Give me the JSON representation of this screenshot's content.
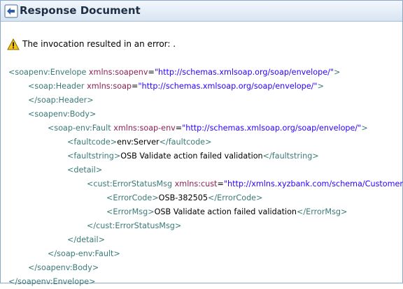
{
  "header": {
    "title": "Response Document",
    "back_icon": "back-arrow-icon"
  },
  "warning": {
    "icon": "warning-icon",
    "text": "The invocation resulted in an error: ."
  },
  "xml": {
    "l1_tag": "<soapenv:Envelope",
    "l1_attr": "xmlns:soapenv",
    "l1_eq": "=",
    "l1_val": "\"http://schemas.xmlsoap.org/soap/envelope/\"",
    "l1_end": ">",
    "l2_tag": "<soap:Header",
    "l2_attr": "xmlns:soap",
    "l2_eq": "=",
    "l2_val": "\"http://schemas.xmlsoap.org/soap/envelope/\"",
    "l2_end": ">",
    "l3_tag": "</soap:Header>",
    "l4_tag": "<soapenv:Body>",
    "l5_tag": "<soap-env:Fault",
    "l5_attr": "xmlns:soap-env",
    "l5_eq": "=",
    "l5_val": "\"http://schemas.xmlsoap.org/soap/envelope/\"",
    "l5_end": ">",
    "l6_open": "<faultcode>",
    "l6_text": "env:Server",
    "l6_close": "</faultcode>",
    "l7_open": "<faultstring>",
    "l7_text": "OSB Validate action failed validation",
    "l7_close": "</faultstring>",
    "l8_tag": "<detail>",
    "l9_tag": "<cust:ErrorStatusMsg",
    "l9_attr": "xmlns:cust",
    "l9_eq": "=",
    "l9_val": "\"http://xmlns.xyzbank.com/schema/Customer\"",
    "l9_end": ">",
    "l10_open": "<ErrorCode>",
    "l10_text": "OSB-382505",
    "l10_close": "</ErrorCode>",
    "l11_open": "<ErrorMsg>",
    "l11_text": "OSB Validate action failed validation",
    "l11_close": "</ErrorMsg>",
    "l12_tag": "</cust:ErrorStatusMsg>",
    "l13_tag": "</detail>",
    "l14_tag": "</soap-env:Fault>",
    "l15_tag": "</soapenv:Body>",
    "l16_tag": "</soapenv:Envelope>"
  },
  "colors": {
    "tag": "#3a7a78",
    "attr": "#8b2252",
    "value": "#2a00ff",
    "header_bg": "#d8e4f2"
  }
}
